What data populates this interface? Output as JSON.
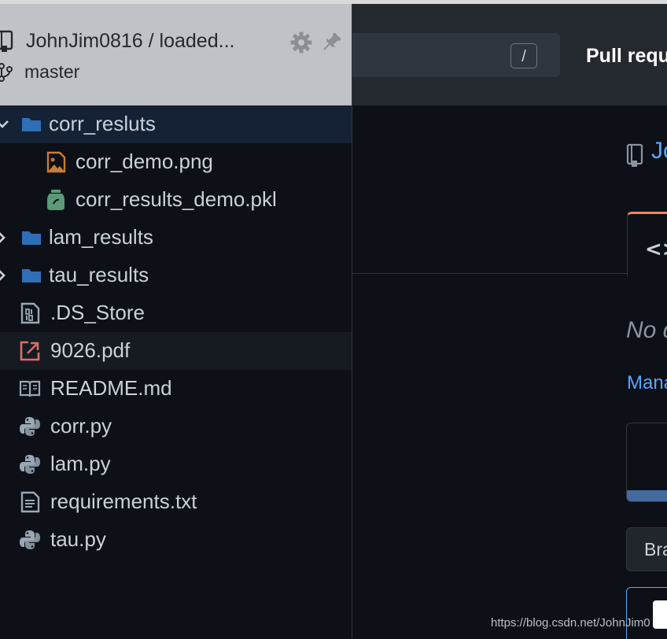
{
  "sidebar": {
    "repo": "JohnJim0816 / loaded...",
    "branch": "master",
    "tree": [
      {
        "name": "corr_resluts",
        "type": "folder",
        "expanded": true,
        "depth": 0,
        "icon": "folder-icon",
        "selected": true
      },
      {
        "name": "corr_demo.png",
        "type": "file",
        "depth": 1,
        "icon": "image-file-icon"
      },
      {
        "name": "corr_results_demo.pkl",
        "type": "file",
        "depth": 1,
        "icon": "jar-file-icon"
      },
      {
        "name": "lam_results",
        "type": "folder",
        "expanded": false,
        "depth": 0,
        "icon": "folder-icon"
      },
      {
        "name": "tau_results",
        "type": "folder",
        "expanded": false,
        "depth": 0,
        "icon": "folder-icon"
      },
      {
        "name": ".DS_Store",
        "type": "file",
        "depth": 0,
        "icon": "binary-file-icon"
      },
      {
        "name": "9026.pdf",
        "type": "file",
        "depth": 0,
        "icon": "pdf-file-icon",
        "hovered": true
      },
      {
        "name": "README.md",
        "type": "file",
        "depth": 0,
        "icon": "readme-book-icon"
      },
      {
        "name": "corr.py",
        "type": "file",
        "depth": 0,
        "icon": "python-file-icon"
      },
      {
        "name": "lam.py",
        "type": "file",
        "depth": 0,
        "icon": "python-file-icon"
      },
      {
        "name": "requirements.txt",
        "type": "file",
        "depth": 0,
        "icon": "text-file-icon"
      },
      {
        "name": "tau.py",
        "type": "file",
        "depth": 0,
        "icon": "python-file-icon"
      }
    ]
  },
  "page": {
    "search_shortcut": "/",
    "nav_pulls": "Pull requ",
    "repo_title": "Jo",
    "code_tab_icon": "<>",
    "no_description": "No d",
    "manage_link": "Mana",
    "branch_button": "Bra"
  },
  "watermark": "https://blog.csdn.net/JohnJim0",
  "colors": {
    "folder": "#2f6fb7",
    "link": "#58a6ff",
    "image_icon": "#c97b37",
    "jar_icon": "#5a9a78",
    "pdf_icon": "#e06c62",
    "file_icon": "#9aa7b4",
    "tab_accent": "#f78166"
  }
}
